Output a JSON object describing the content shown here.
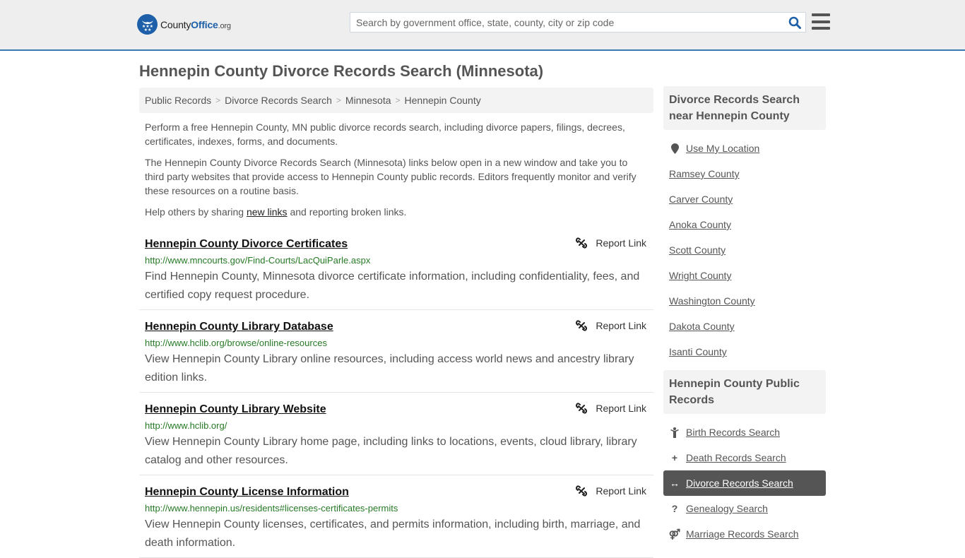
{
  "header": {
    "logo": {
      "name_a": "County",
      "name_b": "Office",
      "tld": ".org",
      "brand_color": "#1d5fa8"
    },
    "search": {
      "placeholder": "Search by government office, state, county, city or zip code",
      "value": ""
    },
    "accent_color": "#3a7ab0"
  },
  "page": {
    "title": "Hennepin County Divorce Records Search (Minnesota)"
  },
  "breadcrumb": [
    "Public Records",
    "Divorce Records Search",
    "Minnesota",
    "Hennepin County"
  ],
  "intro": {
    "p1": "Perform a free Hennepin County, MN public divorce records search, including divorce papers, filings, decrees, certificates, indexes, forms, and documents.",
    "p2": "The Hennepin County Divorce Records Search (Minnesota) links below open in a new window and take you to third party websites that provide access to Hennepin County public records. Editors frequently monitor and verify these resources on a routine basis.",
    "p3_before": "Help others by sharing ",
    "p3_link": "new links",
    "p3_after": " and reporting broken links."
  },
  "results": [
    {
      "title": "Hennepin County Divorce Certificates",
      "url": "http://www.mncourts.gov/Find-Courts/LacQuiParle.aspx",
      "description": "Find Hennepin County, Minnesota divorce certificate information, including confidentiality, fees, and certified copy request procedure.",
      "report_label": "Report Link"
    },
    {
      "title": "Hennepin County Library Database",
      "url": "http://www.hclib.org/browse/online-resources",
      "description": "View Hennepin County Library online resources, including access world news and ancestry library edition links.",
      "report_label": "Report Link"
    },
    {
      "title": "Hennepin County Library Website",
      "url": "http://www.hclib.org/",
      "description": "View Hennepin County Library home page, including links to locations, events, cloud library, library catalog and other resources.",
      "report_label": "Report Link"
    },
    {
      "title": "Hennepin County License Information",
      "url": "http://www.hennepin.us/residents#licenses-certificates-permits",
      "description": "View Hennepin County licenses, certificates, and permits information, including birth, marriage, and death information.",
      "report_label": "Report Link"
    }
  ],
  "sidebar": {
    "nearby": {
      "heading": "Divorce Records Search near Hennepin County",
      "use_location": "Use My Location",
      "counties": [
        "Ramsey County",
        "Carver County",
        "Anoka County",
        "Scott County",
        "Wright County",
        "Washington County",
        "Dakota County",
        "Isanti County"
      ]
    },
    "public_records": {
      "heading": "Hennepin County Public Records",
      "items": [
        {
          "label": "Birth Records Search",
          "icon": "child-icon",
          "glyph": "🯅",
          "active": false
        },
        {
          "label": "Death Records Search",
          "icon": "plus-icon",
          "glyph": "+",
          "active": false
        },
        {
          "label": "Divorce Records Search",
          "icon": "arrows-horizontal-icon",
          "glyph": "↔",
          "active": true
        },
        {
          "label": "Genealogy Search",
          "icon": "question-icon",
          "glyph": "?",
          "active": false
        },
        {
          "label": "Marriage Records Search",
          "icon": "venus-mars-icon",
          "glyph": "⚤",
          "active": false
        }
      ]
    }
  }
}
